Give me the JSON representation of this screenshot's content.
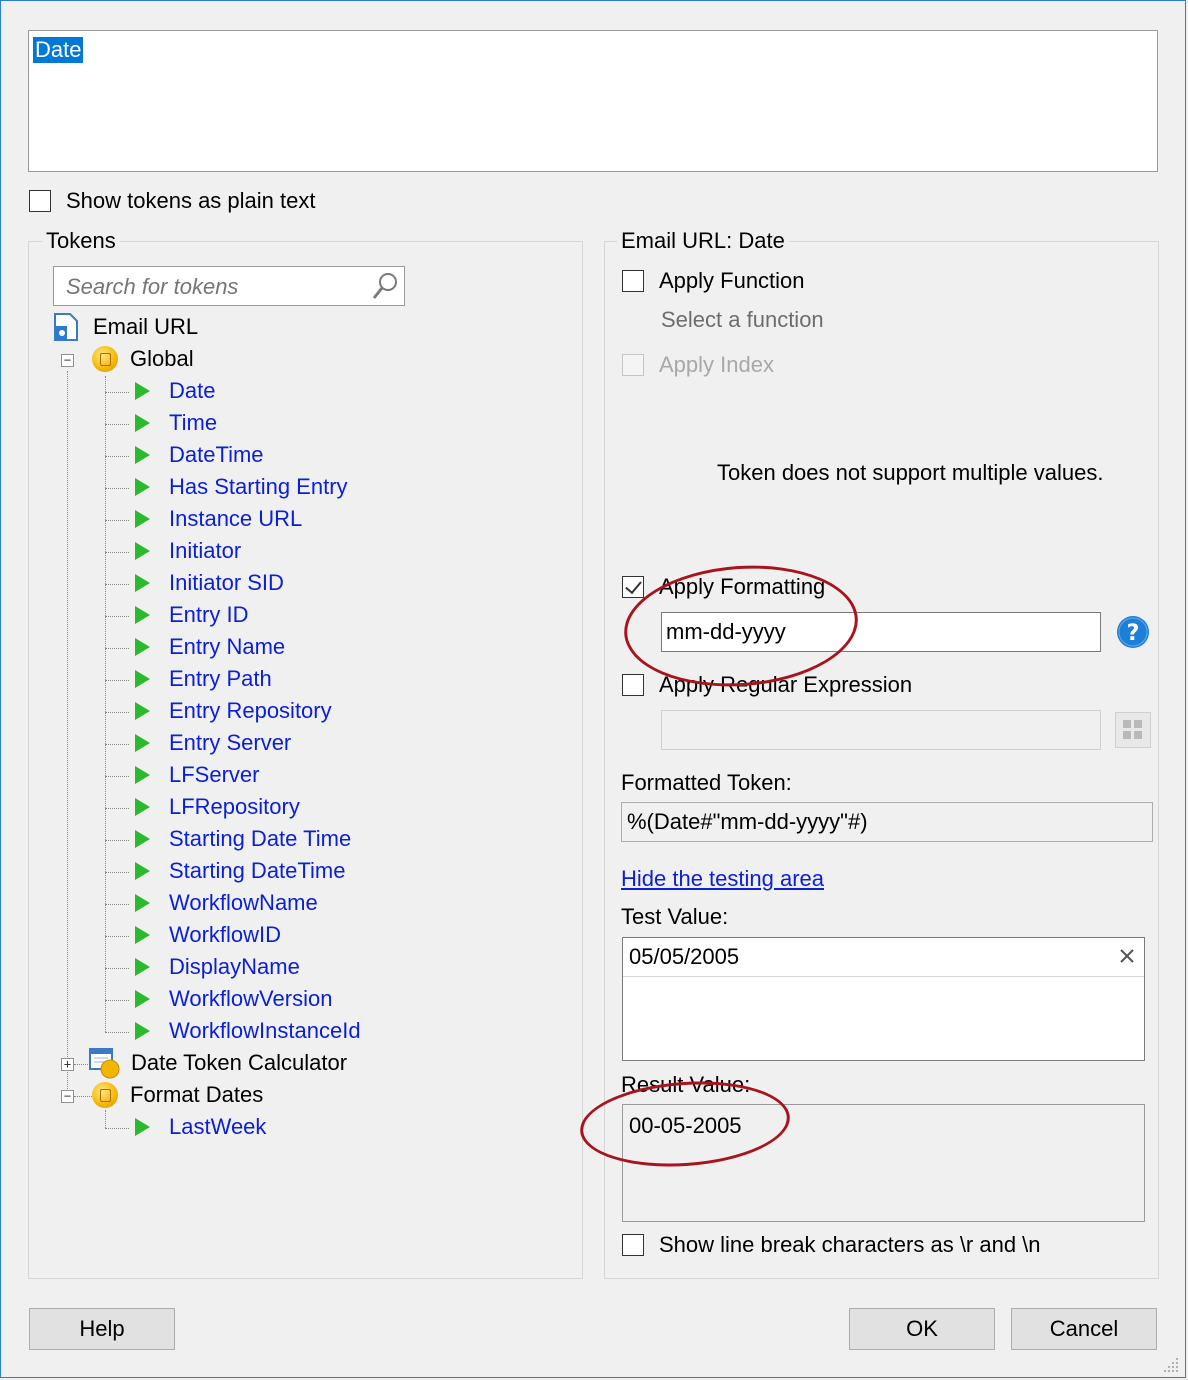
{
  "token_box": {
    "value": "Date"
  },
  "show_plain_text": {
    "label": "Show tokens as plain text",
    "checked": false
  },
  "tokens_panel": {
    "title": "Tokens",
    "search_placeholder": "Search for tokens",
    "root": "Email URL",
    "global": {
      "label": "Global",
      "items": [
        "Date",
        "Time",
        "DateTime",
        "Has Starting Entry",
        "Instance URL",
        "Initiator",
        "Initiator SID",
        "Entry ID",
        "Entry Name",
        "Entry Path",
        "Entry Repository",
        "Entry Server",
        "LFServer",
        "LFRepository",
        "Starting Date Time",
        "Starting DateTime",
        "WorkflowName",
        "WorkflowID",
        "DisplayName",
        "WorkflowVersion",
        "WorkflowInstanceId"
      ]
    },
    "date_token_calculator": "Date Token Calculator",
    "format_dates": {
      "label": "Format Dates",
      "items": [
        "LastWeek"
      ]
    }
  },
  "options_panel": {
    "title": "Email URL: Date",
    "apply_function": {
      "label": "Apply Function",
      "checked": false
    },
    "select_function": "Select a function",
    "apply_index": {
      "label": "Apply Index",
      "checked": false
    },
    "multiple_values_note": "Token does not support multiple values.",
    "apply_formatting": {
      "label": "Apply Formatting",
      "checked": true,
      "value": "mm-dd-yyyy"
    },
    "apply_regex": {
      "label": "Apply Regular Expression",
      "checked": false,
      "value": ""
    },
    "formatted_token_label": "Formatted Token:",
    "formatted_token_value": "%(Date#\"mm-dd-yyyy\"#)",
    "hide_testing_link": "Hide the testing area",
    "test_value_label": "Test Value:",
    "test_value": "05/05/2005",
    "result_value_label": "Result Value:",
    "result_value": "00-05-2005",
    "show_line_breaks": {
      "label": "Show line break characters as \\r and \\n",
      "checked": false
    }
  },
  "buttons": {
    "help": "Help",
    "ok": "OK",
    "cancel": "Cancel"
  },
  "colors": {
    "link": "#0a1fd6",
    "highlight": "#0078d7",
    "annotation": "#a8141e",
    "tree_arrow": "#2eb82e"
  }
}
